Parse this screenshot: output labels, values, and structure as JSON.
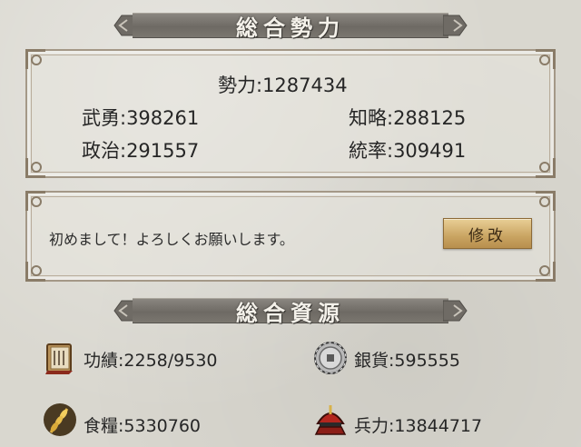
{
  "sections": {
    "power_title": "総合勢力",
    "resources_title": "総合資源"
  },
  "power": {
    "total": "勢力:1287434",
    "bravery": "武勇:398261",
    "intelligence": "知略:288125",
    "politics": "政治:291557",
    "command": "統率:309491"
  },
  "profile": {
    "message": "初めまして！よろしくお願いします。",
    "edit_label": "修改"
  },
  "resources": {
    "merit": {
      "text": "功績:2258/9530",
      "icon": "scroll-book-icon"
    },
    "silver": {
      "text": "銀貨:595555",
      "icon": "silver-coin-icon"
    },
    "food": {
      "text": "食糧:5330760",
      "icon": "wheat-icon"
    },
    "troops": {
      "text": "兵力:13844717",
      "icon": "samurai-helmet-icon"
    }
  },
  "colors": {
    "background": "#d9d7cf",
    "banner": "#7a766f",
    "frame": "#a49887",
    "button_gold": "#c9a462"
  }
}
